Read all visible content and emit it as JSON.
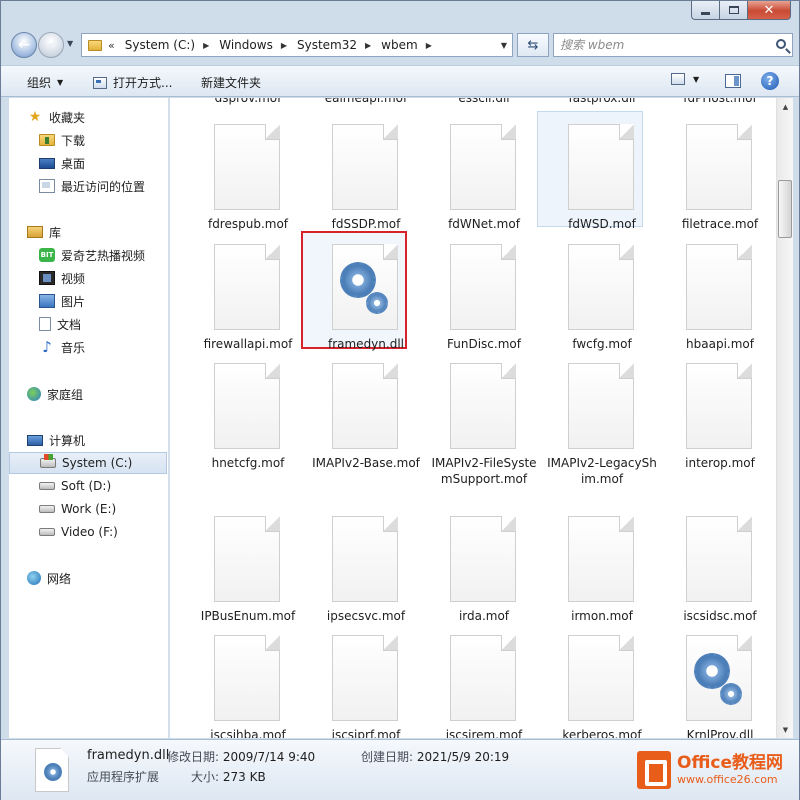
{
  "address": {
    "overflow": "«",
    "crumbs": [
      "System (C:)",
      "Windows",
      "System32",
      "wbem"
    ]
  },
  "search": {
    "placeholder": "搜索 wbem"
  },
  "toolbar": {
    "organize": "组织",
    "open_with": "打开方式...",
    "new_folder": "新建文件夹"
  },
  "nav": {
    "favorites": "收藏夹",
    "downloads": "下载",
    "desktop": "桌面",
    "recent": "最近访问的位置",
    "libraries": "库",
    "iqiyi": "爱奇艺热播视频",
    "iqiyi_badge": "BIT",
    "videos": "视频",
    "pictures": "图片",
    "documents": "文档",
    "music": "音乐",
    "homegroup": "家庭组",
    "computer": "计算机",
    "drive_c": "System (C:)",
    "drive_d": "Soft (D:)",
    "drive_e": "Work (E:)",
    "drive_f": "Video (F:)",
    "network": "网络"
  },
  "top_row_labels": [
    "dsprov.mof",
    "eaimeapi.mof",
    "esscli.dll",
    "fastprox.dll",
    "fdPHost.mof"
  ],
  "files": [
    {
      "name": "fdrespub.mof",
      "icon": "blank-file-icon"
    },
    {
      "name": "fdSSDP.mof",
      "icon": "blank-file-icon"
    },
    {
      "name": "fdWNet.mof",
      "icon": "blank-file-icon"
    },
    {
      "name": "fdWSD.mof",
      "icon": "blank-file-icon",
      "selected": true
    },
    {
      "name": "filetrace.mof",
      "icon": "blank-file-icon"
    },
    {
      "name": "firewallapi.mof",
      "icon": "blank-file-icon"
    },
    {
      "name": "framedyn.dll",
      "icon": "dll-gear-icon",
      "highlighted": true
    },
    {
      "name": "FunDisc.mof",
      "icon": "blank-file-icon"
    },
    {
      "name": "fwcfg.mof",
      "icon": "blank-file-icon"
    },
    {
      "name": "hbaapi.mof",
      "icon": "blank-file-icon"
    },
    {
      "name": "hnetcfg.mof",
      "icon": "blank-file-icon"
    },
    {
      "name": "IMAPIv2-Base.mof",
      "icon": "blank-file-icon"
    },
    {
      "name": "IMAPIv2-FileSystemSupport.mof",
      "icon": "blank-file-icon"
    },
    {
      "name": "IMAPIv2-LegacyShim.mof",
      "icon": "blank-file-icon"
    },
    {
      "name": "interop.mof",
      "icon": "blank-file-icon"
    },
    {
      "name": "IPBusEnum.mof",
      "icon": "blank-file-icon"
    },
    {
      "name": "ipsecsvc.mof",
      "icon": "blank-file-icon"
    },
    {
      "name": "irda.mof",
      "icon": "blank-file-icon"
    },
    {
      "name": "irmon.mof",
      "icon": "blank-file-icon"
    },
    {
      "name": "iscsidsc.mof",
      "icon": "blank-file-icon"
    },
    {
      "name": "iscsihba.mof",
      "icon": "blank-file-icon"
    },
    {
      "name": "iscsiprf.mof",
      "icon": "blank-file-icon"
    },
    {
      "name": "iscsirem.mof",
      "icon": "blank-file-icon"
    },
    {
      "name": "kerberos.mof",
      "icon": "blank-file-icon"
    },
    {
      "name": "KrnlProv.dll",
      "icon": "dll-gear-icon"
    }
  ],
  "details": {
    "name": "framedyn.dll",
    "type": "应用程序扩展",
    "modified_label": "修改日期:",
    "modified_value": "2009/7/14 9:40",
    "size_label": "大小:",
    "size_value": "273 KB",
    "created_label": "创建日期:",
    "created_value": "2021/5/9 20:19"
  },
  "watermark": {
    "title": "Office教程网",
    "url": "www.office26.com"
  },
  "colors": {
    "highlight_border": "#d7222a",
    "watermark": "#e95d1b"
  }
}
